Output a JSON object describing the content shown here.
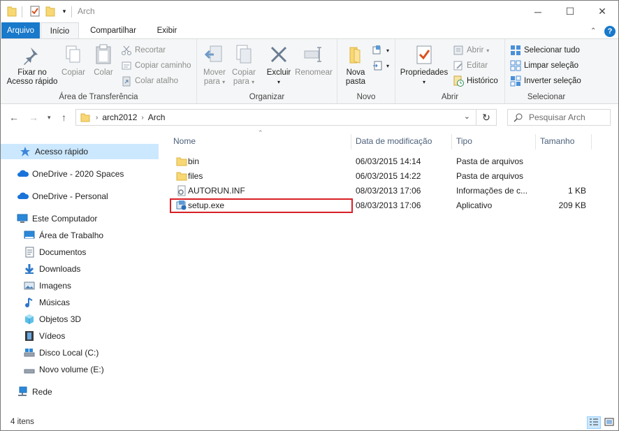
{
  "window": {
    "title": "Arch",
    "controls": {
      "minimize": "─",
      "maximize": "☐",
      "close": "✕"
    }
  },
  "ribbon_tabs": [
    "Arquivo",
    "Início",
    "Compartilhar",
    "Exibir"
  ],
  "ribbon": {
    "clipboard": {
      "pin_line1": "Fixar no",
      "pin_line2": "Acesso rápido",
      "copy": "Copiar",
      "paste": "Colar",
      "cut": "Recortar",
      "copy_path": "Copiar caminho",
      "paste_shortcut": "Colar atalho",
      "group_label": "Área de Transferência"
    },
    "organize": {
      "move_line1": "Mover",
      "move_line2": "para",
      "copy_line1": "Copiar",
      "copy_line2": "para",
      "delete": "Excluir",
      "rename": "Renomear",
      "group_label": "Organizar"
    },
    "new": {
      "new_folder_line1": "Nova",
      "new_folder_line2": "pasta",
      "group_label": "Novo"
    },
    "open": {
      "properties": "Propriedades",
      "open": "Abrir",
      "edit": "Editar",
      "history": "Histórico",
      "group_label": "Abrir"
    },
    "select": {
      "select_all": "Selecionar tudo",
      "select_none": "Limpar seleção",
      "invert": "Inverter seleção",
      "group_label": "Selecionar"
    },
    "accent": "#1979ca"
  },
  "address": {
    "crumbs": [
      "arch2012",
      "Arch"
    ],
    "search_placeholder": "Pesquisar Arch"
  },
  "nav_pane": {
    "quick_access": "Acesso rápido",
    "onedrive_spaces": "OneDrive - 2020 Spaces",
    "onedrive_personal": "OneDrive - Personal",
    "this_pc": "Este Computador",
    "pc_items": [
      "Área de Trabalho",
      "Documentos",
      "Downloads",
      "Imagens",
      "Músicas",
      "Objetos 3D",
      "Vídeos",
      "Disco Local (C:)",
      "Novo volume (E:)"
    ],
    "network": "Rede"
  },
  "columns": [
    "Nome",
    "Data de modificação",
    "Tipo",
    "Tamanho"
  ],
  "files": [
    {
      "name": "bin",
      "date": "06/03/2015 14:14",
      "type": "Pasta de arquivos",
      "size": "",
      "icon": "folder-icon"
    },
    {
      "name": "files",
      "date": "06/03/2015 14:22",
      "type": "Pasta de arquivos",
      "size": "",
      "icon": "folder-icon"
    },
    {
      "name": "AUTORUN.INF",
      "date": "08/03/2013 17:06",
      "type": "Informações de c...",
      "size": "1 KB",
      "icon": "settings-file-icon"
    },
    {
      "name": "setup.exe",
      "date": "08/03/2013 17:06",
      "type": "Aplicativo",
      "size": "209 KB",
      "icon": "installer-icon"
    }
  ],
  "highlight_color": "#d81f26",
  "status": {
    "item_count": "4 itens"
  }
}
